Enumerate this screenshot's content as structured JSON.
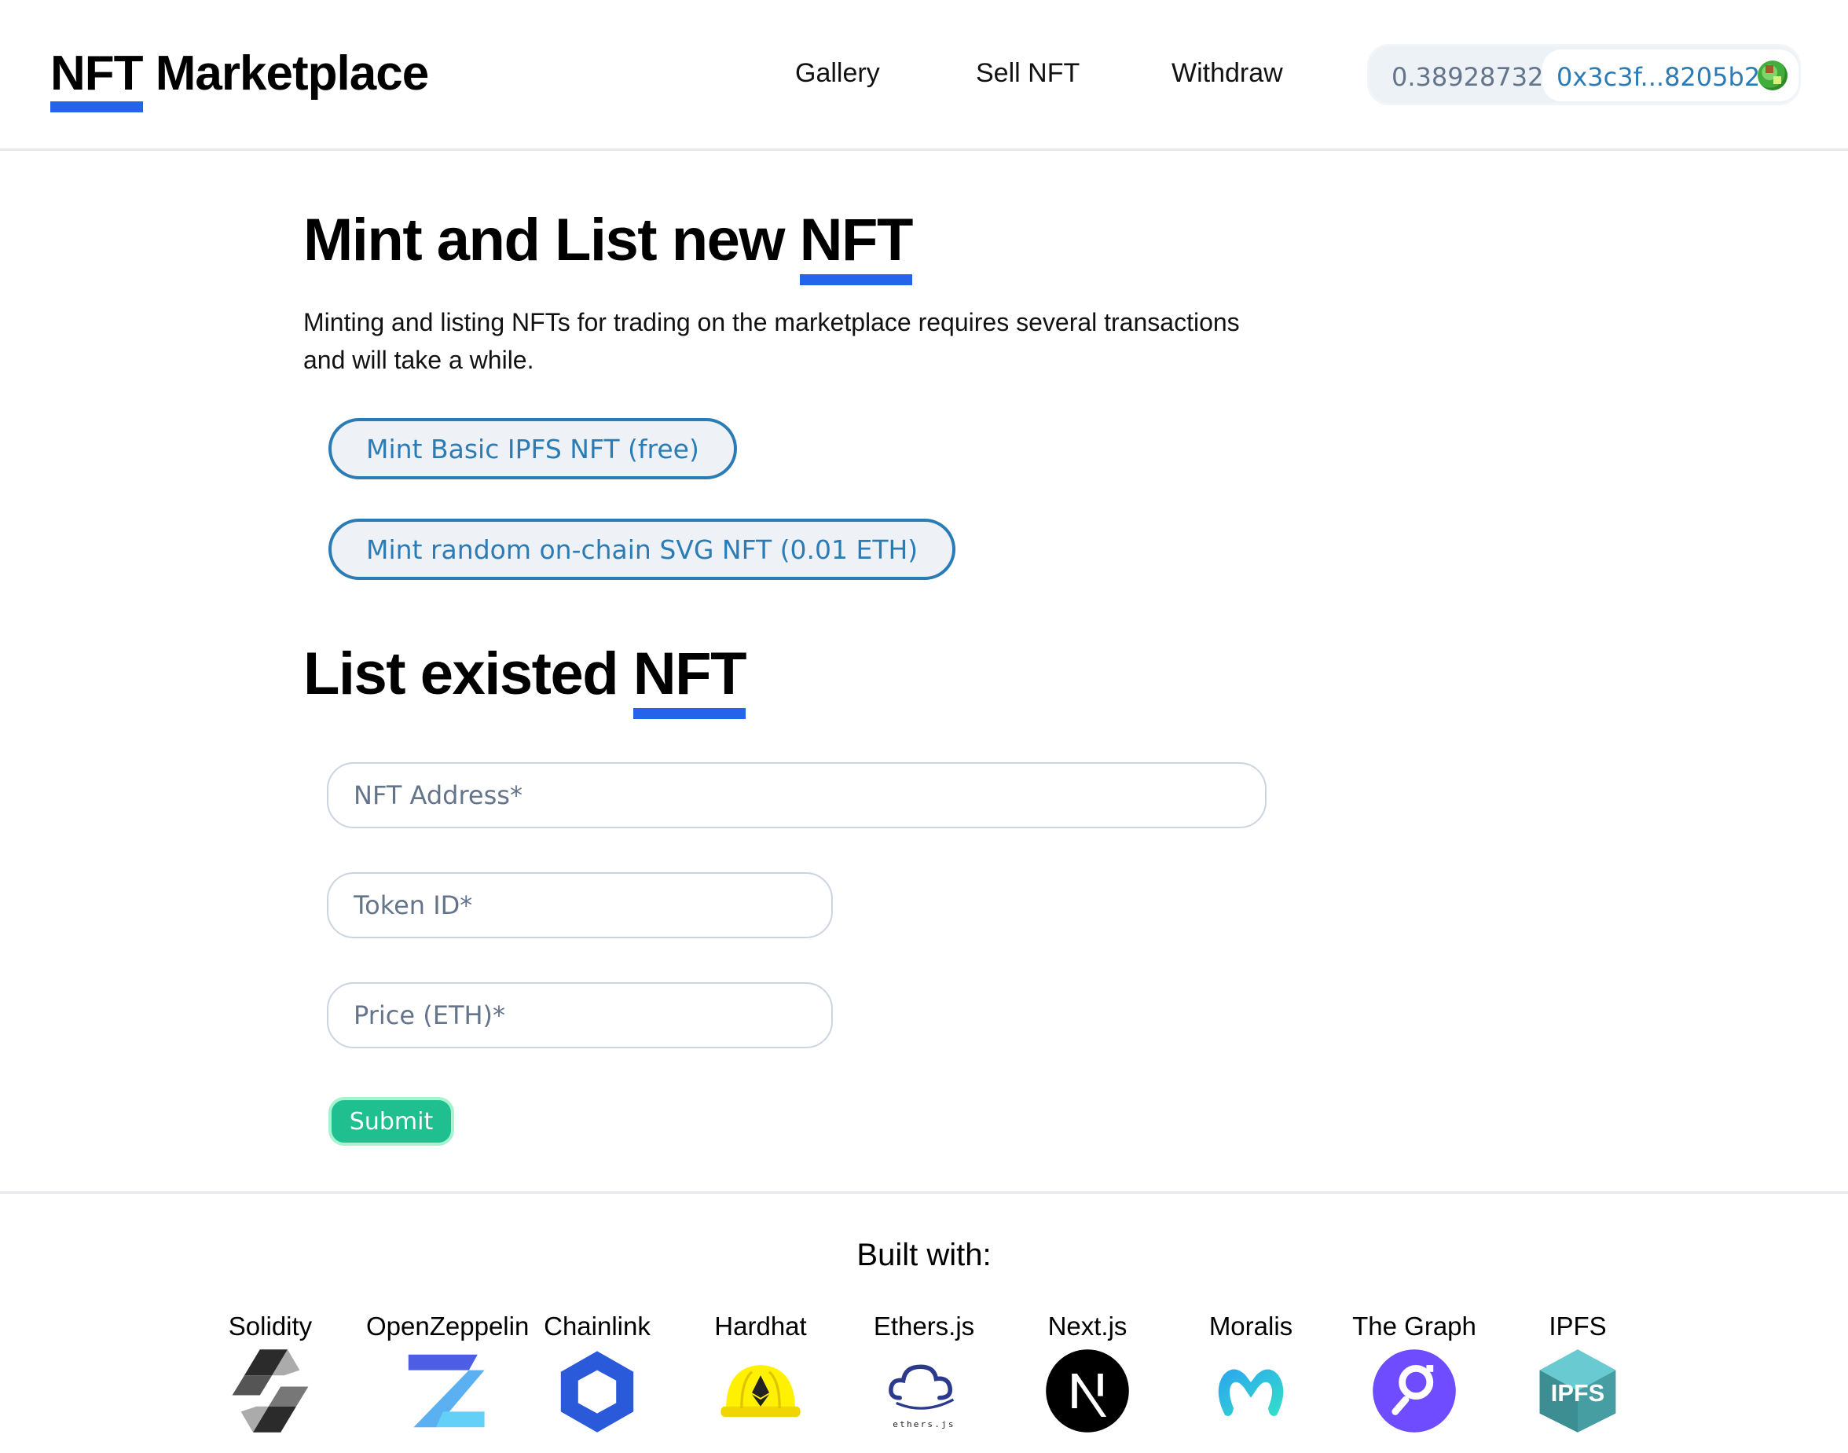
{
  "header": {
    "logo": {
      "word1": "NFT",
      "word2": "Marketplace"
    },
    "nav": [
      {
        "label": "Gallery"
      },
      {
        "label": "Sell NFT"
      },
      {
        "label": "Withdraw"
      }
    ],
    "wallet": {
      "balance": "0.38928732",
      "address": "0x3c3f...8205b2"
    }
  },
  "mint": {
    "title_main": "Mint and List new",
    "title_highlight": "NFT",
    "description": "Minting and listing NFTs for trading on the marketplace requires several transactions and will take a while.",
    "buttons": [
      {
        "label": "Mint Basic IPFS NFT (free)"
      },
      {
        "label": "Mint random on-chain SVG NFT (0.01 ETH)"
      }
    ]
  },
  "list": {
    "title_main": "List existed",
    "title_highlight": "NFT",
    "fields": {
      "nft_address": {
        "placeholder": "NFT Address*",
        "value": ""
      },
      "token_id": {
        "placeholder": "Token ID*",
        "value": ""
      },
      "price": {
        "placeholder": "Price (ETH)*",
        "value": ""
      }
    },
    "submit_label": "Submit"
  },
  "footer": {
    "built_with": "Built with:",
    "tech": [
      {
        "label": "Solidity",
        "icon": "solidity-icon"
      },
      {
        "label": "OpenZeppelin",
        "icon": "openzeppelin-icon"
      },
      {
        "label": "Chainlink",
        "icon": "chainlink-icon"
      },
      {
        "label": "Hardhat",
        "icon": "hardhat-icon"
      },
      {
        "label": "Ethers.js",
        "icon": "ethersjs-icon",
        "icon_caption": "ethers.js"
      },
      {
        "label": "Next.js",
        "icon": "nextjs-icon"
      },
      {
        "label": "Moralis",
        "icon": "moralis-icon"
      },
      {
        "label": "The Graph",
        "icon": "thegraph-icon"
      },
      {
        "label": "IPFS",
        "icon": "ipfs-icon",
        "icon_caption": "IPFS"
      }
    ]
  },
  "colors": {
    "accent_blue": "#2563eb",
    "button_blue": "#2b7bb5",
    "submit_green": "#1fbf8f"
  }
}
